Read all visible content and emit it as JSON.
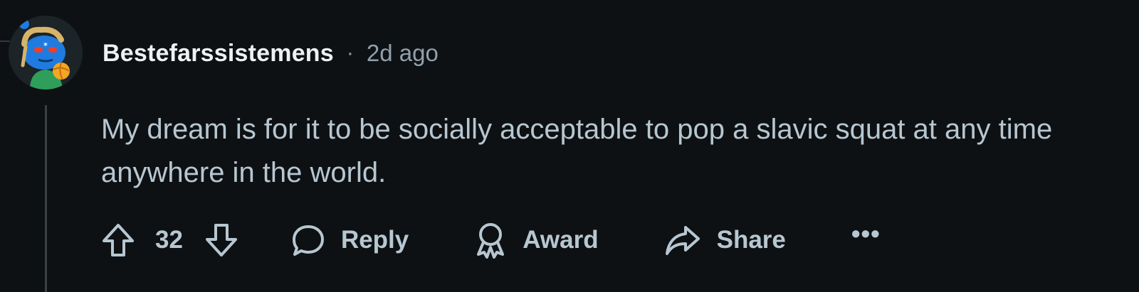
{
  "comment": {
    "username": "Bestefarssistemens",
    "separator": "·",
    "timestamp": "2d ago",
    "body": "My dream is for it to be socially acceptable to pop a slavic squat at any time anywhere in the world.",
    "score": "32"
  },
  "actions": {
    "upvote_icon": "arrow-up-icon",
    "downvote_icon": "arrow-down-icon",
    "reply_label": "Reply",
    "reply_icon": "speech-bubble-icon",
    "award_label": "Award",
    "award_icon": "award-ribbon-icon",
    "share_label": "Share",
    "share_icon": "share-arrow-icon",
    "more_label": "•••",
    "more_icon": "overflow-dots-icon"
  },
  "colors": {
    "background": "#0e1113",
    "username": "#eef1f3",
    "meta": "#8fa1ad",
    "body_text": "#b7c7d1",
    "thread_line": "#3a4146",
    "avatar_primary": "#1f7be0",
    "avatar_accent": "#f5a623"
  }
}
